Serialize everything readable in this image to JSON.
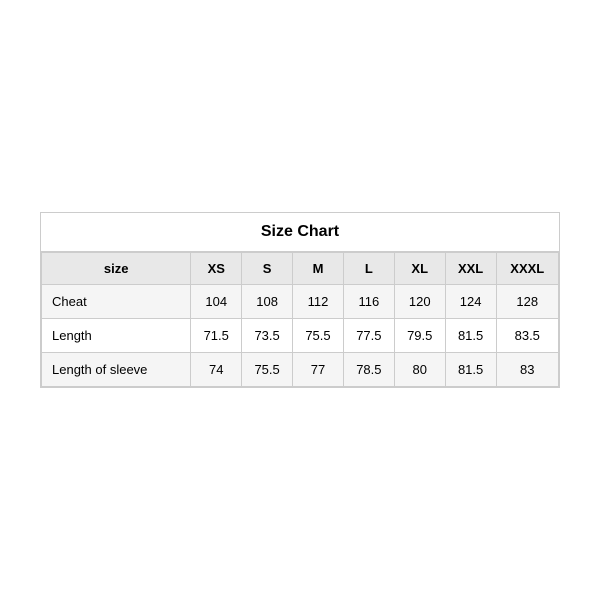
{
  "table": {
    "title": "Size Chart",
    "headers": [
      "size",
      "XS",
      "S",
      "M",
      "L",
      "XL",
      "XXL",
      "XXXL"
    ],
    "rows": [
      {
        "label": "Cheat",
        "values": [
          "104",
          "108",
          "112",
          "116",
          "120",
          "124",
          "128"
        ]
      },
      {
        "label": "Length",
        "values": [
          "71.5",
          "73.5",
          "75.5",
          "77.5",
          "79.5",
          "81.5",
          "83.5"
        ]
      },
      {
        "label": "Length of sleeve",
        "values": [
          "74",
          "75.5",
          "77",
          "78.5",
          "80",
          "81.5",
          "83"
        ]
      }
    ]
  }
}
